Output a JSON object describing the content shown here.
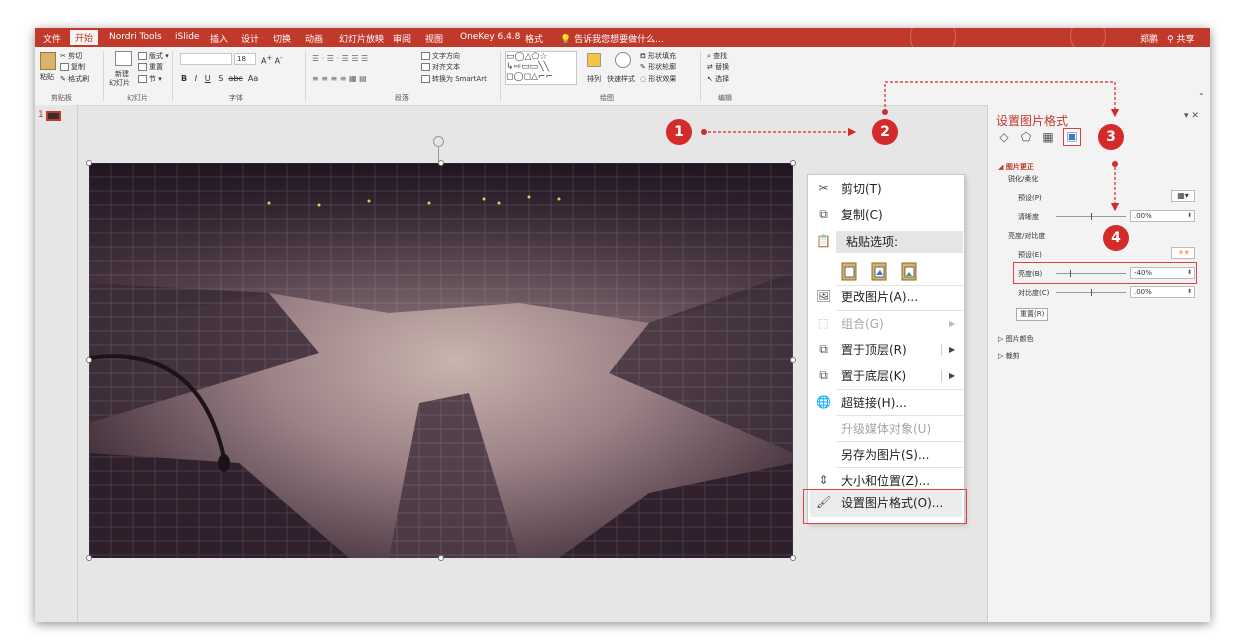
{
  "tabs": [
    "文件",
    "开始",
    "Nordri Tools",
    "iSlide",
    "插入",
    "设计",
    "切换",
    "动画",
    "幻灯片放映",
    "审阅",
    "视图",
    "OneKey 6.4.8",
    "格式"
  ],
  "active_tab_index": 1,
  "tell_me": "告诉我您想要做什么...",
  "user": "郑鹏",
  "share": "共享",
  "ribbon": {
    "clipboard": {
      "paste": "粘贴",
      "cut": "剪切",
      "copy": "复制",
      "format_painter": "格式刷",
      "group": "剪贴板"
    },
    "slides": {
      "new_slide_1": "新建",
      "new_slide_2": "幻灯片",
      "layout": "版式",
      "reset": "重置",
      "section": "节",
      "group": "幻灯片"
    },
    "font": {
      "size": "18",
      "group": "字体",
      "bold": "B",
      "italic": "I",
      "underline": "U",
      "strike": "S",
      "abc": "abc",
      "aa": "Aa"
    },
    "paragraph": {
      "text_direction": "文字方向",
      "align_text": "对齐文本",
      "smartart": "转换为 SmartArt",
      "group": "段落"
    },
    "drawing": {
      "arrange": "排列",
      "quick_styles": "快速样式",
      "shape_fill": "形状填充",
      "shape_outline": "形状轮廓",
      "shape_effects": "形状效果",
      "group": "绘图"
    },
    "editing": {
      "find": "查找",
      "replace": "替换",
      "select": "选择",
      "group": "编辑"
    }
  },
  "thumbnail_number": "1",
  "context_menu": {
    "cut": "剪切(T)",
    "copy": "复制(C)",
    "paste_options": "粘贴选项:",
    "change_picture": "更改图片(A)...",
    "group": "组合(G)",
    "bring_to_front": "置于顶层(R)",
    "send_to_back": "置于底层(K)",
    "hyperlink": "超链接(H)...",
    "upgrade_media": "升级媒体对象(U)",
    "save_as_picture": "另存为图片(S)...",
    "size_position": "大小和位置(Z)...",
    "format_picture": "设置图片格式(O)..."
  },
  "panel": {
    "title": "设置图片格式",
    "section_corrections": "图片更正",
    "sharpen_soften": "锐化/柔化",
    "preset": "预设(P)",
    "sharpness": "清晰度",
    "sharpness_value": ".00%",
    "brightness_contrast": "亮度/对比度",
    "preset2": "预设(E)",
    "brightness": "亮度(B)",
    "brightness_value": "-40%",
    "contrast": "对比度(C)",
    "contrast_value": ".00%",
    "reset": "重置(R)",
    "picture_color": "图片颜色",
    "crop": "裁剪"
  },
  "annotations": {
    "step1": "1",
    "step2": "2",
    "step3": "3",
    "step4": "4"
  },
  "colors": {
    "accent": "#c0392b",
    "badge": "#d42a2a",
    "highlight_box": "#e04040"
  }
}
